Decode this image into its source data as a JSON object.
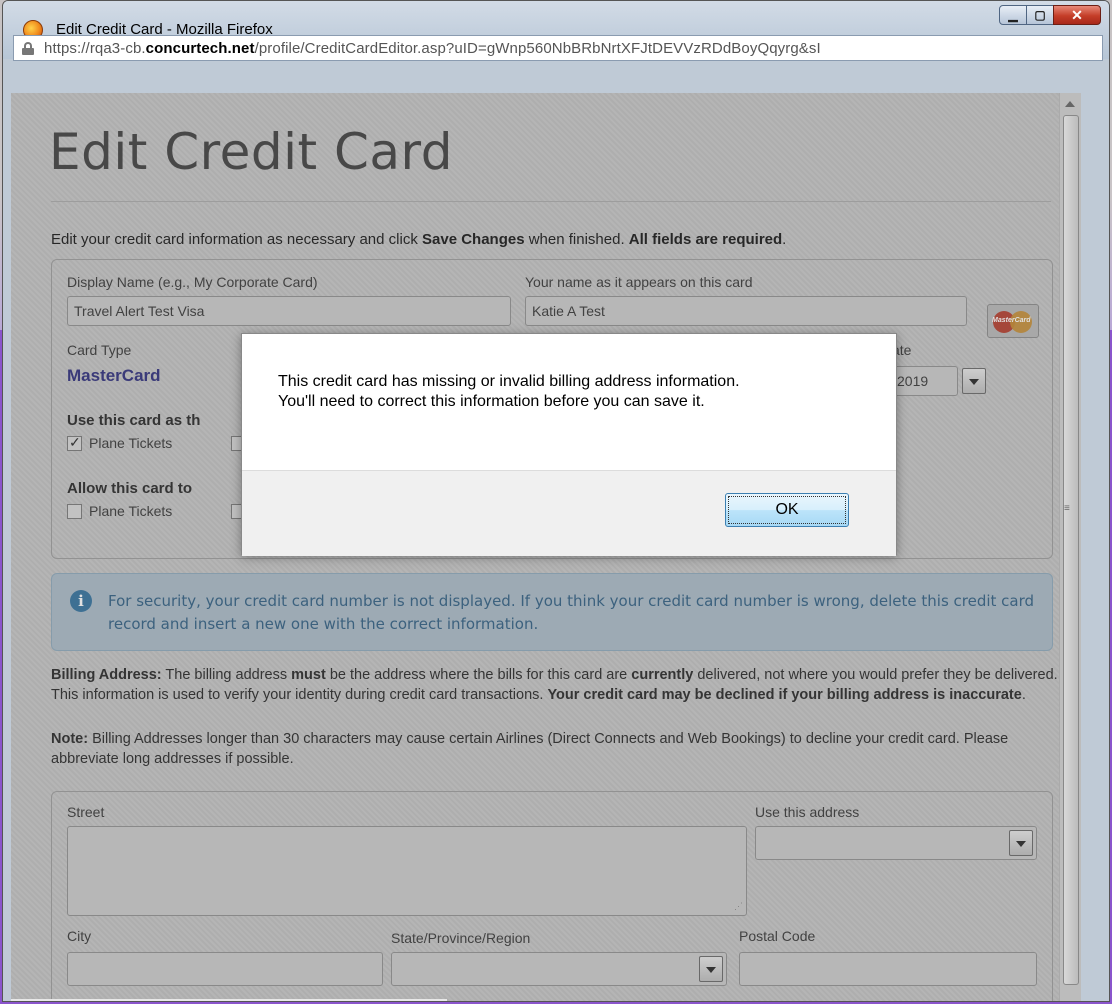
{
  "window": {
    "title": "Edit Credit Card - Mozilla Firefox",
    "url_prefix": "https://rqa3-cb.",
    "url_domain": "concurtech.net",
    "url_path": "/profile/CreditCardEditor.asp?uID=gWnp560NbBRbNrtXFJtDEVVzRDdBoyQqyrg&sI"
  },
  "page": {
    "title": "Edit Credit Card",
    "intro_1": "Edit your credit card information as necessary and click ",
    "intro_bold_1": "Save Changes",
    "intro_2": " when finished. ",
    "intro_bold_2": "All fields are required",
    "intro_3": "."
  },
  "card": {
    "display_name_label": "Display Name (e.g., My Corporate Card)",
    "display_name_value": "Travel Alert Test Visa",
    "card_name_label": "Your name as it appears on this card",
    "card_name_value": "Katie A Test",
    "card_type_label": "Card Type",
    "card_type_value": "MasterCard",
    "expiry_label_partial": "ate",
    "expiry_year": "2019",
    "use_card_heading": "Use this card as th",
    "allow_card_heading": "Allow this card to",
    "plane_tickets_label": "Plane Tickets",
    "plane_tickets_label_2": "Plane Tickets",
    "logo_text": "MasterCard"
  },
  "info": {
    "text": "For security, your credit card number is not displayed. If you think your credit card number is wrong, delete this credit card record and insert a new one with the correct information."
  },
  "billing": {
    "heading": "Billing Address:",
    "p1a": " The billing address ",
    "p1_must": "must",
    "p1b": " be the address where the bills for this card are ",
    "p1_currently": "currently",
    "p1c": " delivered, not where you would prefer they be delivered. This information is used to verify your identity during credit card transactions. ",
    "p1_warning": "Your credit card may be declined if your billing address is inaccurate",
    "p1d": ".",
    "note_label": "Note:",
    "note_text": " Billing Addresses longer than 30 characters may cause certain Airlines (Direct Connects and Web Bookings) to decline your credit card. Please abbreviate long addresses if possible."
  },
  "address": {
    "street_label": "Street",
    "use_address_label": "Use this address",
    "city_label": "City",
    "state_label": "State/Province/Region",
    "postal_label": "Postal Code"
  },
  "dialog": {
    "message_line_1": "This credit card has missing or invalid billing address information.",
    "message_line_2": "You'll need to correct this information before you can save it.",
    "ok_label": "OK"
  }
}
